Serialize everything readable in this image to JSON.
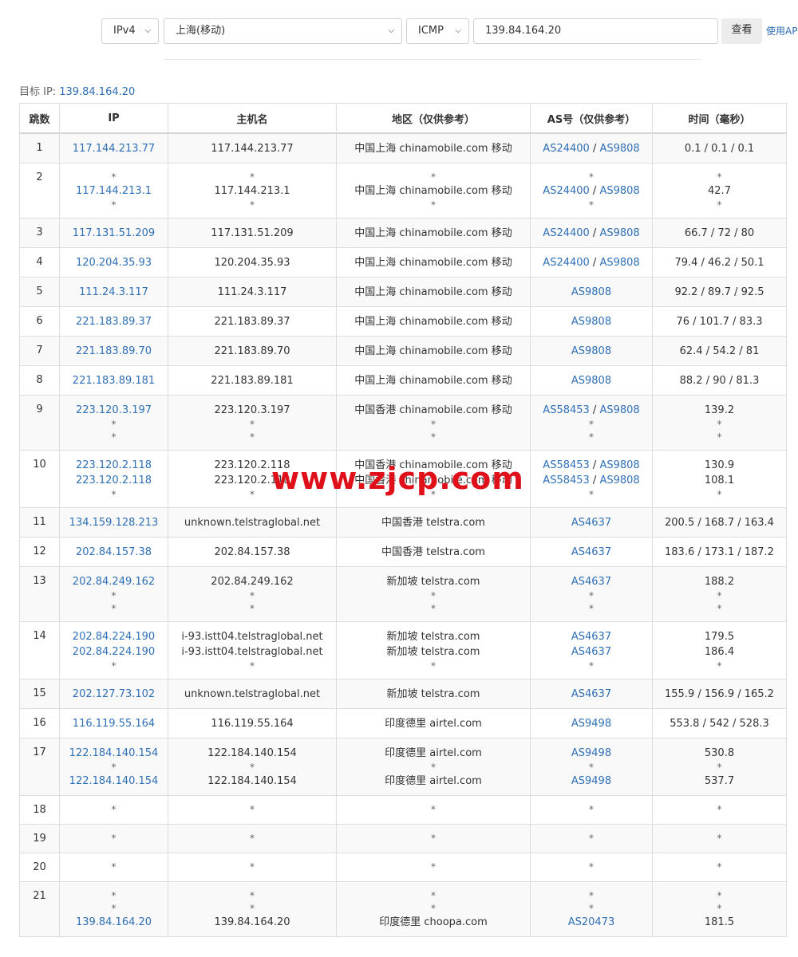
{
  "toolbar": {
    "protocol_version": "IPv4",
    "location": "上海(移动)",
    "method": "ICMP",
    "target_input": "139.84.164.20",
    "query_button": "查看",
    "api_link": "使用AP"
  },
  "target_label": "目标 IP:",
  "target_ip": "139.84.164.20",
  "headers": [
    "跳数",
    "IP",
    "主机名",
    "地区（仅供参考）",
    "AS号（仅供参考）",
    "时间（毫秒）"
  ],
  "hops": [
    {
      "hop": "1",
      "ip": [
        "117.144.213.77"
      ],
      "host": [
        "117.144.213.77"
      ],
      "region": [
        "中国上海 chinamobile.com 移动"
      ],
      "as": [
        [
          "AS24400",
          "AS9808"
        ]
      ],
      "time": [
        "0.1 / 0.1 / 0.1"
      ]
    },
    {
      "hop": "2",
      "ip": [
        "*",
        "117.144.213.1",
        "*"
      ],
      "host": [
        "*",
        "117.144.213.1",
        "*"
      ],
      "region": [
        "*",
        "中国上海 chinamobile.com 移动",
        "*"
      ],
      "as": [
        "*",
        [
          "AS24400",
          "AS9808"
        ],
        "*"
      ],
      "time": [
        "*",
        "42.7",
        "*"
      ]
    },
    {
      "hop": "3",
      "ip": [
        "117.131.51.209"
      ],
      "host": [
        "117.131.51.209"
      ],
      "region": [
        "中国上海 chinamobile.com 移动"
      ],
      "as": [
        [
          "AS24400",
          "AS9808"
        ]
      ],
      "time": [
        "66.7 / 72 / 80"
      ]
    },
    {
      "hop": "4",
      "ip": [
        "120.204.35.93"
      ],
      "host": [
        "120.204.35.93"
      ],
      "region": [
        "中国上海 chinamobile.com 移动"
      ],
      "as": [
        [
          "AS24400",
          "AS9808"
        ]
      ],
      "time": [
        "79.4 / 46.2 / 50.1"
      ]
    },
    {
      "hop": "5",
      "ip": [
        "111.24.3.117"
      ],
      "host": [
        "111.24.3.117"
      ],
      "region": [
        "中国上海 chinamobile.com 移动"
      ],
      "as": [
        [
          "AS9808"
        ]
      ],
      "time": [
        "92.2 / 89.7 / 92.5"
      ]
    },
    {
      "hop": "6",
      "ip": [
        "221.183.89.37"
      ],
      "host": [
        "221.183.89.37"
      ],
      "region": [
        "中国上海 chinamobile.com 移动"
      ],
      "as": [
        [
          "AS9808"
        ]
      ],
      "time": [
        "76 / 101.7 / 83.3"
      ]
    },
    {
      "hop": "7",
      "ip": [
        "221.183.89.70"
      ],
      "host": [
        "221.183.89.70"
      ],
      "region": [
        "中国上海 chinamobile.com 移动"
      ],
      "as": [
        [
          "AS9808"
        ]
      ],
      "time": [
        "62.4 / 54.2 / 81"
      ]
    },
    {
      "hop": "8",
      "ip": [
        "221.183.89.181"
      ],
      "host": [
        "221.183.89.181"
      ],
      "region": [
        "中国上海 chinamobile.com 移动"
      ],
      "as": [
        [
          "AS9808"
        ]
      ],
      "time": [
        "88.2 / 90 / 81.3"
      ]
    },
    {
      "hop": "9",
      "ip": [
        "223.120.3.197",
        "*",
        "*"
      ],
      "host": [
        "223.120.3.197",
        "*",
        "*"
      ],
      "region": [
        "中国香港 chinamobile.com 移动",
        "*",
        "*"
      ],
      "as": [
        [
          "AS58453",
          "AS9808"
        ],
        "*",
        "*"
      ],
      "time": [
        "139.2",
        "*",
        "*"
      ]
    },
    {
      "hop": "10",
      "ip": [
        "223.120.2.118",
        "223.120.2.118",
        "*"
      ],
      "host": [
        "223.120.2.118",
        "223.120.2.118",
        "*"
      ],
      "region": [
        "中国香港 chinamobile.com 移动",
        "中国香港 chinamobile.com 移动",
        "*"
      ],
      "as": [
        [
          "AS58453",
          "AS9808"
        ],
        [
          "AS58453",
          "AS9808"
        ],
        "*"
      ],
      "time": [
        "130.9",
        "108.1",
        "*"
      ]
    },
    {
      "hop": "11",
      "ip": [
        "134.159.128.213"
      ],
      "host": [
        "unknown.telstraglobal.net"
      ],
      "region": [
        "中国香港 telstra.com"
      ],
      "as": [
        [
          "AS4637"
        ]
      ],
      "time": [
        "200.5 / 168.7 / 163.4"
      ]
    },
    {
      "hop": "12",
      "ip": [
        "202.84.157.38"
      ],
      "host": [
        "202.84.157.38"
      ],
      "region": [
        "中国香港 telstra.com"
      ],
      "as": [
        [
          "AS4637"
        ]
      ],
      "time": [
        "183.6 / 173.1 / 187.2"
      ]
    },
    {
      "hop": "13",
      "ip": [
        "202.84.249.162",
        "*",
        "*"
      ],
      "host": [
        "202.84.249.162",
        "*",
        "*"
      ],
      "region": [
        "新加坡 telstra.com",
        "*",
        "*"
      ],
      "as": [
        [
          "AS4637"
        ],
        "*",
        "*"
      ],
      "time": [
        "188.2",
        "*",
        "*"
      ]
    },
    {
      "hop": "14",
      "ip": [
        "202.84.224.190",
        "202.84.224.190",
        "*"
      ],
      "host": [
        "i-93.istt04.telstraglobal.net",
        "i-93.istt04.telstraglobal.net",
        "*"
      ],
      "region": [
        "新加坡 telstra.com",
        "新加坡 telstra.com",
        "*"
      ],
      "as": [
        [
          "AS4637"
        ],
        [
          "AS4637"
        ],
        "*"
      ],
      "time": [
        "179.5",
        "186.4",
        "*"
      ]
    },
    {
      "hop": "15",
      "ip": [
        "202.127.73.102"
      ],
      "host": [
        "unknown.telstraglobal.net"
      ],
      "region": [
        "新加坡 telstra.com"
      ],
      "as": [
        [
          "AS4637"
        ]
      ],
      "time": [
        "155.9 / 156.9 / 165.2"
      ]
    },
    {
      "hop": "16",
      "ip": [
        "116.119.55.164"
      ],
      "host": [
        "116.119.55.164"
      ],
      "region": [
        "印度德里 airtel.com"
      ],
      "as": [
        [
          "AS9498"
        ]
      ],
      "time": [
        "553.8 / 542 / 528.3"
      ]
    },
    {
      "hop": "17",
      "ip": [
        "122.184.140.154",
        "*",
        "122.184.140.154"
      ],
      "host": [
        "122.184.140.154",
        "*",
        "122.184.140.154"
      ],
      "region": [
        "印度德里 airtel.com",
        "*",
        "印度德里 airtel.com"
      ],
      "as": [
        [
          "AS9498"
        ],
        "*",
        [
          "AS9498"
        ]
      ],
      "time": [
        "530.8",
        "*",
        "537.7"
      ]
    },
    {
      "hop": "18",
      "ip": [
        "*"
      ],
      "host": [
        "*"
      ],
      "region": [
        "*"
      ],
      "as": [
        "*"
      ],
      "time": [
        "*"
      ]
    },
    {
      "hop": "19",
      "ip": [
        "*"
      ],
      "host": [
        "*"
      ],
      "region": [
        "*"
      ],
      "as": [
        "*"
      ],
      "time": [
        "*"
      ]
    },
    {
      "hop": "20",
      "ip": [
        "*"
      ],
      "host": [
        "*"
      ],
      "region": [
        "*"
      ],
      "as": [
        "*"
      ],
      "time": [
        "*"
      ]
    },
    {
      "hop": "21",
      "ip": [
        "*",
        "*",
        "139.84.164.20"
      ],
      "host": [
        "*",
        "*",
        "139.84.164.20"
      ],
      "region": [
        "*",
        "*",
        "印度德里 choopa.com"
      ],
      "as": [
        "*",
        "*",
        [
          "AS20473"
        ]
      ],
      "time": [
        "*",
        "*",
        "181.5"
      ]
    }
  ],
  "watermark": "www.zjcp.com",
  "colors": {
    "link": "#2f6fb6",
    "watermark": "#e0101a",
    "row_alt": "#f9f9f9",
    "border": "#dddddd"
  }
}
